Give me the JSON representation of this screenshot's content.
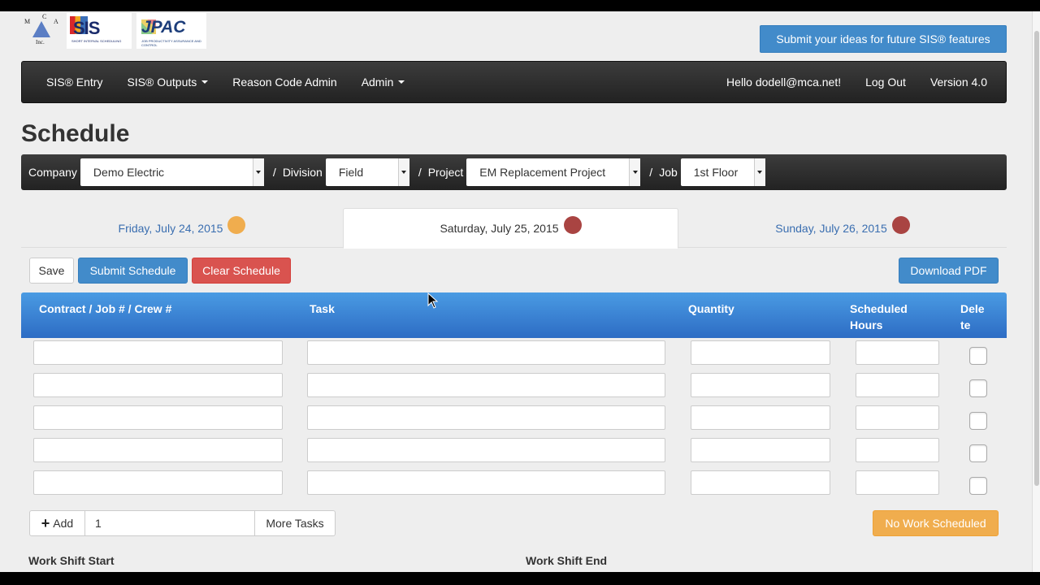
{
  "header": {
    "logos": [
      {
        "name": "mca-logo",
        "text": "MCA Inc."
      },
      {
        "name": "sis-logo",
        "text": "SIS"
      },
      {
        "name": "jpac-logo",
        "text": "JPAC"
      }
    ],
    "ideas_button": "Submit your ideas for future SIS® features"
  },
  "nav": {
    "items": [
      {
        "label": "SIS® Entry",
        "dropdown": false
      },
      {
        "label": "SIS® Outputs",
        "dropdown": true
      },
      {
        "label": "Reason Code Admin",
        "dropdown": false
      },
      {
        "label": "Admin",
        "dropdown": true
      }
    ],
    "user_greeting": "Hello dodell@mca.net!",
    "logout": "Log Out",
    "version": "Version 4.0"
  },
  "page_title": "Schedule",
  "filters": {
    "company_label": "Company",
    "company_value": "Demo Electric",
    "sep": "/",
    "division_label": "Division",
    "division_value": "Field",
    "project_label": "Project",
    "project_value": "EM Replacement Project",
    "job_label": "Job",
    "job_value": "1st Floor"
  },
  "date_tabs": [
    {
      "label": "Friday, July 24, 2015",
      "status_color": "#f0ad4e",
      "active": false
    },
    {
      "label": "Saturday, July 25, 2015",
      "status_color": "#a94442",
      "active": true
    },
    {
      "label": "Sunday, July 26, 2015",
      "status_color": "#a94442",
      "active": false
    }
  ],
  "actions": {
    "save": "Save",
    "submit": "Submit Schedule",
    "clear": "Clear Schedule",
    "download_pdf": "Download PDF"
  },
  "table": {
    "columns": {
      "contract": "Contract / Job # / Crew #",
      "task": "Task",
      "quantity": "Quantity",
      "hours_line1": "Scheduled",
      "hours_line2": "Hours",
      "delete_line1": "Dele",
      "delete_line2": "te"
    },
    "rows": [
      {
        "contract": "",
        "task": "",
        "quantity": "",
        "hours": "",
        "delete": false
      },
      {
        "contract": "",
        "task": "",
        "quantity": "",
        "hours": "",
        "delete": false
      },
      {
        "contract": "",
        "task": "",
        "quantity": "",
        "hours": "",
        "delete": false
      },
      {
        "contract": "",
        "task": "",
        "quantity": "",
        "hours": "",
        "delete": false
      },
      {
        "contract": "",
        "task": "",
        "quantity": "",
        "hours": "",
        "delete": false
      }
    ]
  },
  "add_group": {
    "add_label": "Add",
    "count_value": "1",
    "more_tasks": "More Tasks"
  },
  "status_button": "No Work Scheduled",
  "shift": {
    "start_label": "Work Shift Start",
    "end_label": "Work Shift End"
  }
}
